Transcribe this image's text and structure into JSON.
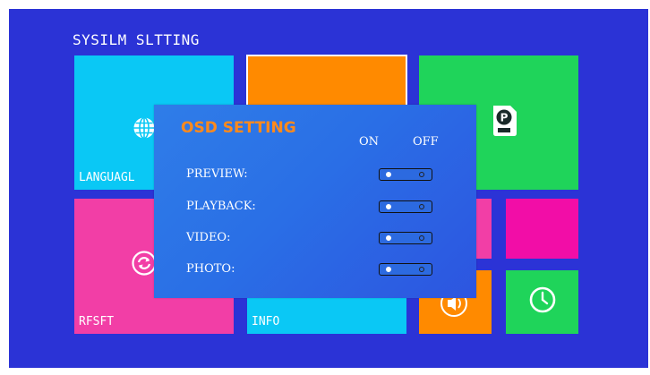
{
  "screen": {
    "title": "SYSILM SLTTING",
    "background": "#2b33d6"
  },
  "tiles": [
    {
      "id": "language",
      "label": "LANGUAGL",
      "color": "#0ac8f5",
      "icon": "globe-icon"
    },
    {
      "id": "orange",
      "label": "",
      "color": "#ff8a00",
      "icon": ""
    },
    {
      "id": "storage",
      "label": "",
      "color": "#1fd45a",
      "icon": "hdd-icon"
    },
    {
      "id": "reset",
      "label": "RFSFT",
      "color": "#f23ea6",
      "icon": "refresh-icon"
    },
    {
      "id": "info",
      "label": "INFO",
      "color": "#0ac8f5",
      "icon": ""
    },
    {
      "id": "pink-small",
      "label": "",
      "color": "#f23ea6",
      "icon": ""
    },
    {
      "id": "magenta",
      "label": "",
      "color": "#f20da7",
      "icon": ""
    },
    {
      "id": "volume",
      "label": "",
      "color": "#ff8a00",
      "icon": "speaker-icon"
    },
    {
      "id": "time",
      "label": "",
      "color": "#1fd45a",
      "icon": "clock-icon"
    }
  ],
  "osd": {
    "title": "OSD SETTING",
    "title_color": "#ff8a1c",
    "on_label": "ON",
    "off_label": "OFF",
    "options": [
      {
        "label": "PREVIEW:",
        "state": "on"
      },
      {
        "label": "PLAYBACK:",
        "state": "on"
      },
      {
        "label": "VIDEO:",
        "state": "on"
      },
      {
        "label": "PHOTO:",
        "state": "on"
      }
    ]
  }
}
